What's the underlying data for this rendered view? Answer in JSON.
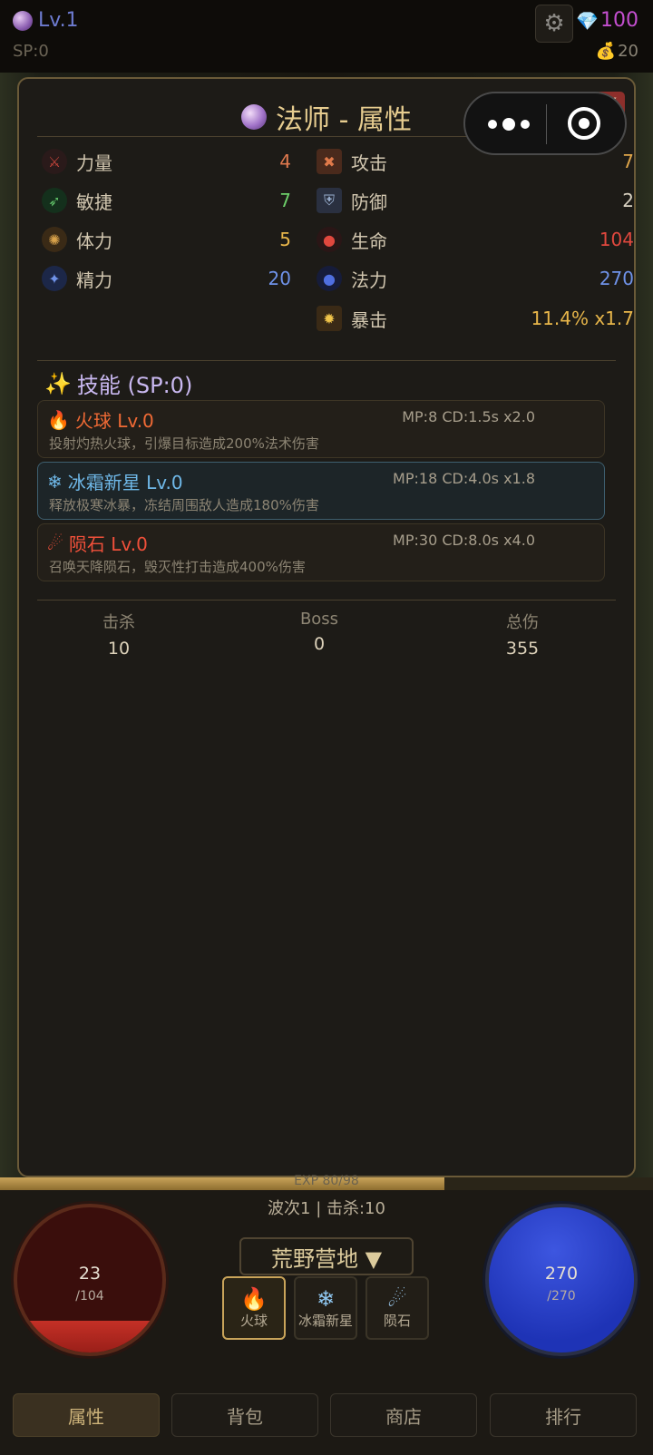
{
  "topbar": {
    "level": "Lv.1",
    "sp": "SP:0",
    "gems": "100",
    "gold": "20"
  },
  "panel": {
    "title": "法师 - 属性",
    "close": "X",
    "stats_left": [
      {
        "label": "力量",
        "value": "4",
        "color": "#e0794e",
        "icon": "strength-icon"
      },
      {
        "label": "敏捷",
        "value": "7",
        "color": "#6dd06a",
        "icon": "agility-icon"
      },
      {
        "label": "体力",
        "value": "5",
        "color": "#e8b64a",
        "icon": "stamina-icon"
      },
      {
        "label": "精力",
        "value": "20",
        "color": "#6f92e8",
        "icon": "energy-icon"
      }
    ],
    "stats_right": [
      {
        "label": "攻击",
        "value": "7",
        "color": "#e0a64a",
        "icon": "attack-icon"
      },
      {
        "label": "防御",
        "value": "2",
        "color": "#d9d2c2",
        "icon": "defense-icon"
      },
      {
        "label": "生命",
        "value": "104",
        "color": "#e0483e",
        "icon": "life-icon"
      },
      {
        "label": "法力",
        "value": "270",
        "color": "#6f92e8",
        "icon": "mana-icon"
      },
      {
        "label": "暴击",
        "value": "11.4%  x1.7",
        "color": "#e8b64a",
        "icon": "crit-icon"
      }
    ],
    "skills_header": "技能 (SP:0)",
    "skills": [
      {
        "name": "火球 Lv.0",
        "meta": "MP:8 CD:1.5s x2.0",
        "desc": "投射灼热火球，引爆目标造成200%法术伤害",
        "color": "#f06a35",
        "icon": "🔥"
      },
      {
        "name": "冰霜新星 Lv.0",
        "meta": "MP:18 CD:4.0s x1.8",
        "desc": "释放极寒冰暴，冻结周围敌人造成180%伤害",
        "color": "#6fb8e8",
        "icon": "❄"
      },
      {
        "name": "陨石 Lv.0",
        "meta": "MP:30 CD:8.0s x4.0",
        "desc": "召唤天降陨石，毁灭性打击造成400%伤害",
        "color": "#f0503a",
        "icon": "☄"
      }
    ],
    "totals": [
      {
        "label": "击杀",
        "value": "10"
      },
      {
        "label": "Boss",
        "value": "0"
      },
      {
        "label": "总伤",
        "value": "355"
      }
    ]
  },
  "exp": {
    "text": "EXP 80/98",
    "progress": 0.68
  },
  "hud": {
    "hp": {
      "current": "23",
      "max": "/104",
      "fraction": 0.22
    },
    "mp": {
      "current": "270",
      "max": "/270",
      "fraction": 1.0
    },
    "wave": "波次1 | 击杀:10",
    "zone": "荒野营地 ▼",
    "skill_buttons": [
      {
        "label": "火球",
        "icon": "🔥"
      },
      {
        "label": "冰霜新星",
        "icon": "❄"
      },
      {
        "label": "陨石",
        "icon": "☄"
      }
    ]
  },
  "tabs": [
    "属性",
    "背包",
    "商店",
    "排行"
  ]
}
